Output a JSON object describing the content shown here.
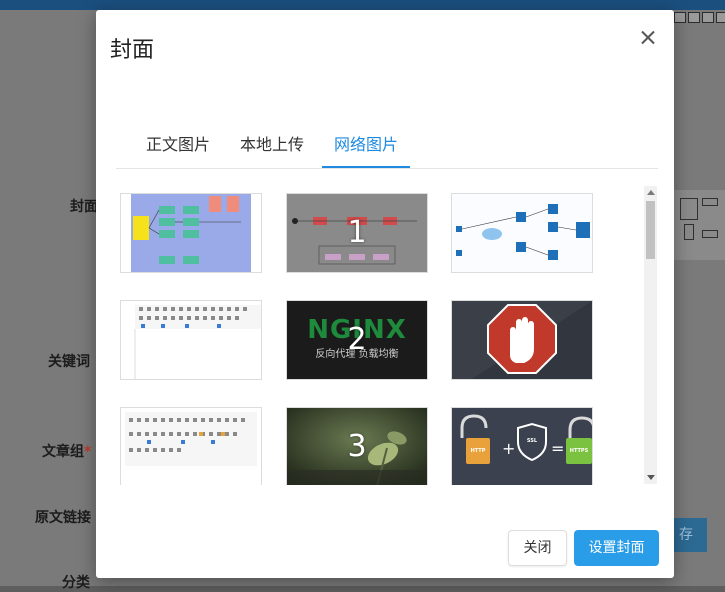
{
  "background": {
    "form_labels": {
      "cover": "封面",
      "keywords": "关键词",
      "article_group": "文章组",
      "required_mark": "*",
      "source_link": "原文链接",
      "category": "分类"
    },
    "save_button_partial": "存"
  },
  "modal": {
    "title": "封面",
    "tabs": [
      {
        "label": "正文图片",
        "active": false
      },
      {
        "label": "本地上传",
        "active": false
      },
      {
        "label": "网络图片",
        "active": true
      }
    ],
    "thumbnails": [
      {
        "number": "",
        "subject": "flow diagram"
      },
      {
        "number": "1",
        "subject": "state flow diagram"
      },
      {
        "number": "",
        "subject": "network architecture diagram"
      },
      {
        "number": "",
        "subject": "editor toolbar screenshot"
      },
      {
        "number": "2",
        "subject": "nginx banner",
        "banner_logo": "NGINX",
        "banner_caption": "反向代理 负载均衡"
      },
      {
        "number": "",
        "subject": "stop hand sign"
      },
      {
        "number": "",
        "subject": "editor toolbar screenshot"
      },
      {
        "number": "3",
        "subject": "plant photo"
      },
      {
        "number": "",
        "subject": "http vs https illustration",
        "labels": [
          "HTTP",
          "SSL",
          "HTTPS"
        ]
      }
    ],
    "buttons": {
      "close": "关闭",
      "set_cover": "设置封面"
    }
  },
  "colors": {
    "accent": "#2a9de8",
    "tab_active": "#1f8ae0",
    "required": "#c0392b"
  }
}
